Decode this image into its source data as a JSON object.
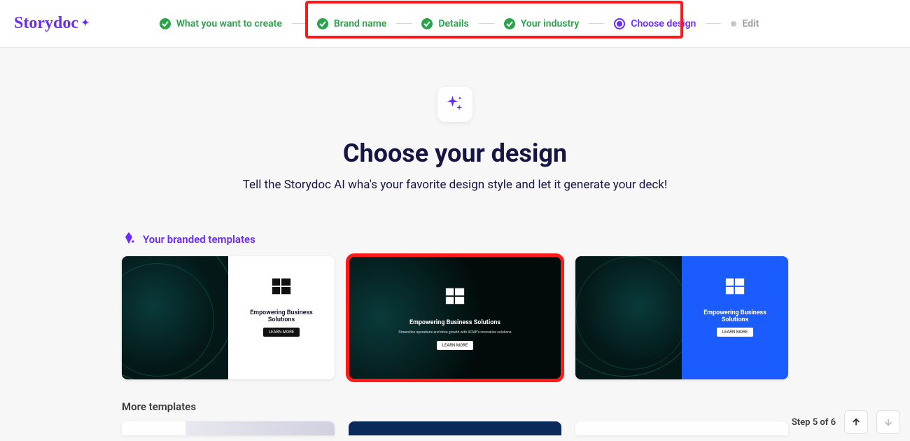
{
  "brand": "Storydoc",
  "steps": [
    {
      "label": "What you want to create",
      "state": "done"
    },
    {
      "label": "Brand name",
      "state": "done"
    },
    {
      "label": "Details",
      "state": "done"
    },
    {
      "label": "Your industry",
      "state": "done"
    },
    {
      "label": "Choose design",
      "state": "current"
    },
    {
      "label": "Edit",
      "state": "pending"
    }
  ],
  "hero": {
    "title": "Choose your design",
    "subtitle": "Tell the Storydoc AI wha's your favorite design style and let it generate your deck!"
  },
  "branded_section": {
    "label": "Your branded templates"
  },
  "templates": [
    {
      "title": "Empowering Business Solutions",
      "subtitle": "",
      "button": "LEARN MORE",
      "selected": false
    },
    {
      "title": "Empowering Business Solutions",
      "subtitle": "Streamline operations and drive growth with ACME's innovative solutions",
      "button": "LEARN MORE",
      "selected": true
    },
    {
      "title": "Empowering Business Solutions",
      "subtitle": "",
      "button": "LEARN MORE",
      "selected": false
    }
  ],
  "more_templates": {
    "label": "More templates"
  },
  "footer": {
    "step_counter": "Step 5 of 6"
  }
}
